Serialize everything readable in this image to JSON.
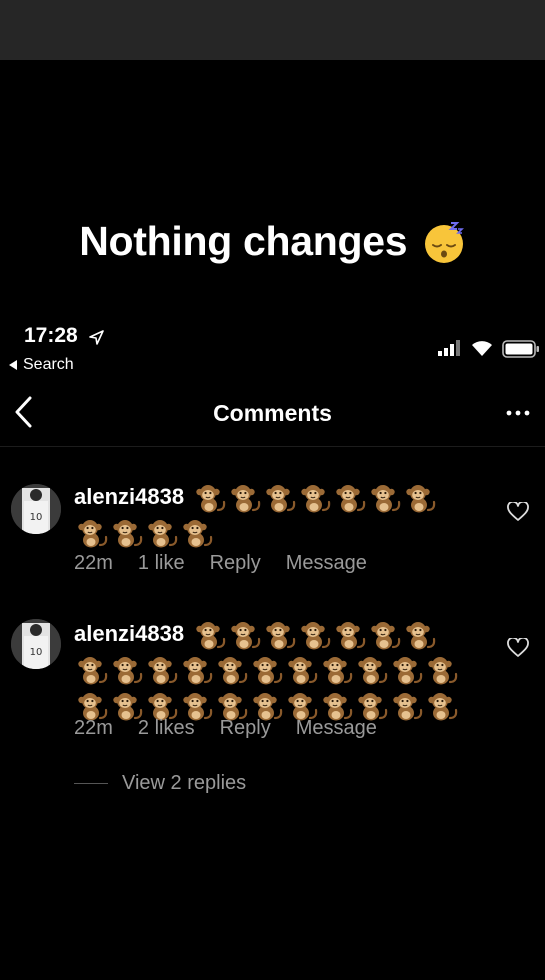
{
  "caption": {
    "text": "Nothing changes",
    "emoji": "sleeping-face-emoji"
  },
  "status_bar": {
    "time": "17:28",
    "back_label": "Search"
  },
  "nav": {
    "title": "Comments"
  },
  "comments": [
    {
      "username": "alenzi4838",
      "monkeys_first_line": 7,
      "monkeys_next_lines": [
        4
      ],
      "time": "22m",
      "likes": "1 like",
      "reply": "Reply",
      "message": "Message"
    },
    {
      "username": "alenzi4838",
      "monkeys_first_line": 7,
      "monkeys_next_lines": [
        11,
        11
      ],
      "time": "22m",
      "likes": "2 likes",
      "reply": "Reply",
      "message": "Message"
    }
  ],
  "view_replies": "View 2 replies",
  "colors": {
    "background": "#000000",
    "top_bar": "#262626",
    "secondary_text": "#9a9a9a"
  }
}
